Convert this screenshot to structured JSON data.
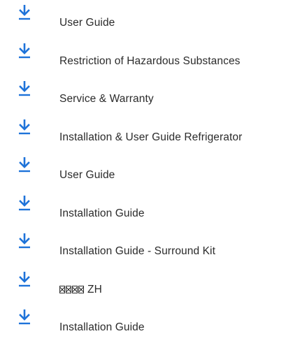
{
  "colors": {
    "accent": "#1e73d9",
    "text": "#2b2b2b",
    "background": "#ffffff"
  },
  "icon": "download-icon",
  "documents": [
    {
      "label": "User Guide"
    },
    {
      "label": "Restriction of Hazardous Substances"
    },
    {
      "label": "Service & Warranty"
    },
    {
      "label": "Installation & User Guide Refrigerator"
    },
    {
      "label": "User Guide"
    },
    {
      "label": "Installation Guide"
    },
    {
      "label": "Installation Guide - Surround Kit"
    },
    {
      "label": "ZH",
      "prefix_glyphs": 4
    },
    {
      "label": "Installation Guide"
    }
  ]
}
